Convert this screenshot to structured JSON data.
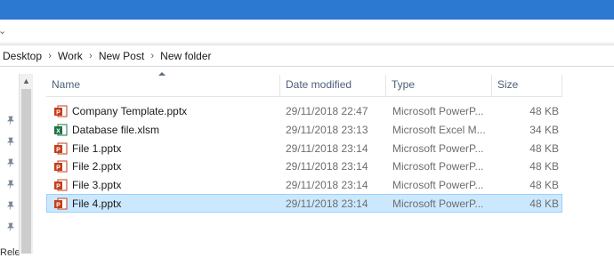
{
  "ribbon": {
    "chevron": "⌄"
  },
  "address": {
    "crumbs": [
      "Desktop",
      "Work",
      "New Post",
      "New folder"
    ],
    "separator": "›"
  },
  "nav": {
    "partial_label": "Rele"
  },
  "columns": {
    "name": "Name",
    "date": "Date modified",
    "type": "Type",
    "size": "Size"
  },
  "files": [
    {
      "name": "Company Template.pptx",
      "date": "29/11/2018 22:47",
      "type": "Microsoft PowerP...",
      "size": "48 KB",
      "icon": "powerpoint-icon"
    },
    {
      "name": "Database file.xlsm",
      "date": "29/11/2018 23:13",
      "type": "Microsoft Excel M...",
      "size": "34 KB",
      "icon": "excel-icon"
    },
    {
      "name": "File 1.pptx",
      "date": "29/11/2018 23:14",
      "type": "Microsoft PowerP...",
      "size": "48 KB",
      "icon": "powerpoint-icon"
    },
    {
      "name": "File 2.pptx",
      "date": "29/11/2018 23:14",
      "type": "Microsoft PowerP...",
      "size": "48 KB",
      "icon": "powerpoint-icon"
    },
    {
      "name": "File 3.pptx",
      "date": "29/11/2018 23:14",
      "type": "Microsoft PowerP...",
      "size": "48 KB",
      "icon": "powerpoint-icon"
    },
    {
      "name": "File 4.pptx",
      "date": "29/11/2018 23:14",
      "type": "Microsoft PowerP...",
      "size": "48 KB",
      "icon": "powerpoint-icon",
      "selected": true
    }
  ],
  "colors": {
    "titlebar": "#2b79d0",
    "selection": "#cce8ff",
    "selection_border": "#99d1ff",
    "powerpoint": "#c43e1c",
    "excel": "#1e7145"
  }
}
